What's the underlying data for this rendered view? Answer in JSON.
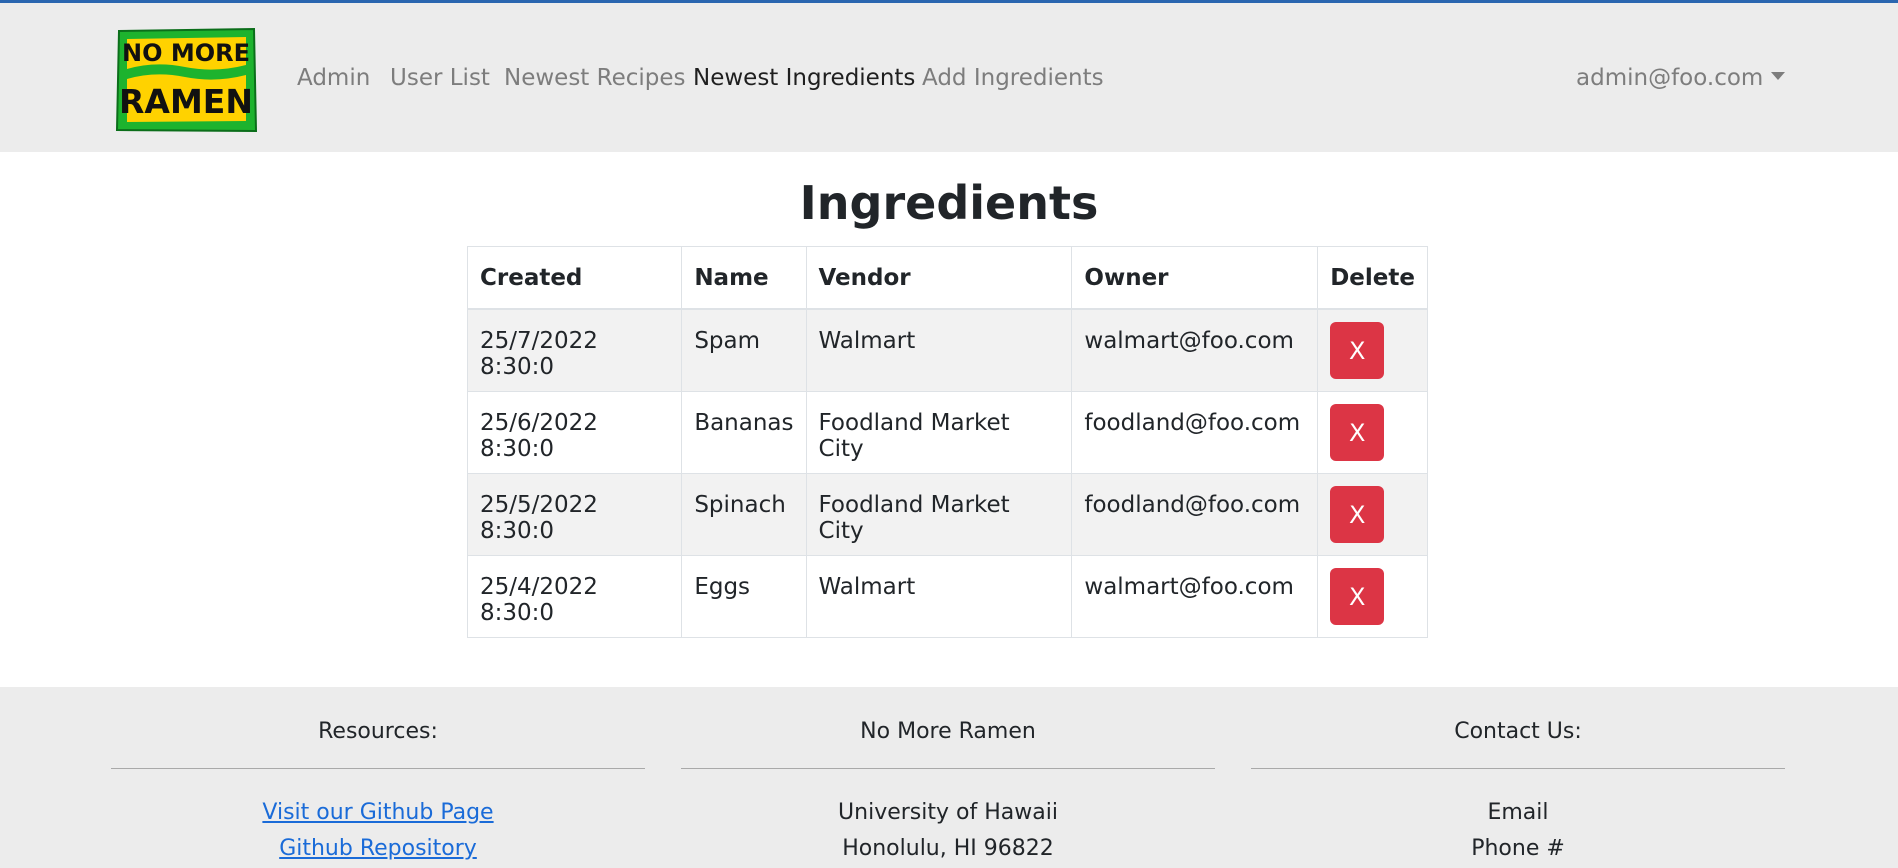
{
  "navbar": {
    "logo_text_line1": "NO MORE",
    "logo_text_line2": "RAMEN",
    "links": [
      {
        "label": "Admin",
        "active": false
      },
      {
        "label": "User List",
        "active": false
      },
      {
        "label": "Newest Recipes",
        "active": false
      },
      {
        "label": "Newest Ingredients",
        "active": true
      },
      {
        "label": "Add Ingredients",
        "active": false
      }
    ],
    "user": "admin@foo.com"
  },
  "page": {
    "title": "Ingredients"
  },
  "table": {
    "headers": [
      "Created",
      "Name",
      "Vendor",
      "Owner",
      "Delete"
    ],
    "rows": [
      {
        "created": "25/7/2022 8:30:0",
        "name": "Spam",
        "vendor": "Walmart",
        "owner": "walmart@foo.com",
        "delete_label": "X"
      },
      {
        "created": "25/6/2022 8:30:0",
        "name": "Bananas",
        "vendor": "Foodland Market City",
        "owner": "foodland@foo.com",
        "delete_label": "X"
      },
      {
        "created": "25/5/2022 8:30:0",
        "name": "Spinach",
        "vendor": "Foodland Market City",
        "owner": "foodland@foo.com",
        "delete_label": "X"
      },
      {
        "created": "25/4/2022 8:30:0",
        "name": "Eggs",
        "vendor": "Walmart",
        "owner": "walmart@foo.com",
        "delete_label": "X"
      }
    ]
  },
  "footer": {
    "resources": {
      "heading": "Resources:",
      "links": [
        "Visit our Github Page",
        "Github Repository"
      ]
    },
    "center": {
      "heading": "No More Ramen",
      "lines": [
        "University of Hawaii",
        "Honolulu, HI 96822"
      ]
    },
    "contact": {
      "heading": "Contact Us:",
      "lines": [
        "Email",
        "Phone #"
      ]
    }
  },
  "colors": {
    "navbar_bg": "#ececec",
    "delete_button": "#dc3545",
    "link": "#1a6bd8",
    "logo_green": "#1db32e",
    "logo_yellow": "#ffd200"
  }
}
